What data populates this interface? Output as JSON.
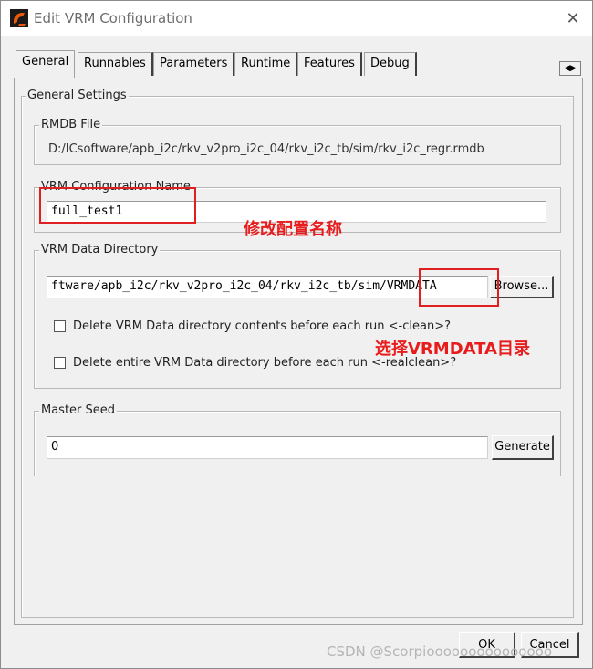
{
  "window": {
    "title": "Edit VRM Configuration",
    "accent": "#e02020"
  },
  "tabs": [
    {
      "label": "General",
      "active": true
    },
    {
      "label": "Runnables"
    },
    {
      "label": "Parameters"
    },
    {
      "label": "Runtime"
    },
    {
      "label": "Features"
    },
    {
      "label": "Debug"
    }
  ],
  "general_settings": {
    "legend": "General Settings",
    "rmdb": {
      "legend": "RMDB File",
      "path": "D:/ICsoftware/apb_i2c/rkv_v2pro_i2c_04/rkv_i2c_tb/sim/rkv_i2c_regr.rmdb"
    },
    "config_name": {
      "legend": "VRM Configuration Name",
      "value": "full_test1"
    },
    "data_directory": {
      "legend": "VRM Data Directory",
      "value": "ftware/apb_i2c/rkv_v2pro_i2c_04/rkv_i2c_tb/sim/VRMDATA",
      "browse_label": "Browse...",
      "clean_label": "Delete VRM Data directory contents before each run <-clean>?",
      "realclean_label": "Delete entire VRM Data directory before each run <-realclean>?",
      "clean_checked": false,
      "realclean_checked": false
    },
    "master_seed": {
      "legend": "Master Seed",
      "value": "0",
      "generate_label": "Generate"
    }
  },
  "footer": {
    "ok_label": "OK",
    "cancel_label": "Cancel"
  },
  "annotations": {
    "rename": "修改配置名称",
    "select_dir": "选择VRMDATA目录",
    "watermark": "CSDN @Scorpiooooooooooooooo"
  },
  "icons": {
    "app": "app-logo-icon",
    "close": "close-icon",
    "tab_scroll": "tab-scroll-arrows-icon"
  }
}
